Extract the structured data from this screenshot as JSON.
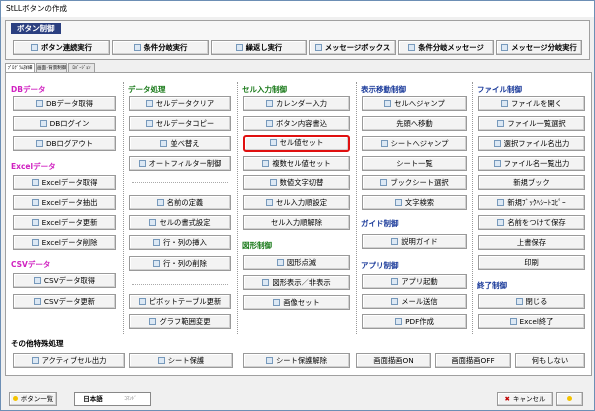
{
  "window": {
    "title": "StLLボタンの作成"
  },
  "top": {
    "title": "ボタン制御",
    "buttons": [
      "ボタン連続実行",
      "条件分岐実行",
      "繰返し実行",
      "メッセージボックス",
      "条件分岐メッセージ",
      "メッセージ分岐実行"
    ]
  },
  "tabs": [
    "ﾌﾟﾛｸﾞﾗﾑ詳細",
    "画面･背景制御",
    "ﾛﾊﾞｰｼﾞｮﾝ"
  ],
  "sections": {
    "db": {
      "title": "DBデータ",
      "buttons": [
        "DBデータ取得",
        "DBログイン",
        "DBログアウト"
      ]
    },
    "excel": {
      "title": "Excelデータ",
      "buttons": [
        "Excelデータ取得",
        "Excelデータ抽出",
        "Excelデータ更新",
        "Excelデータ削除"
      ]
    },
    "csv": {
      "title": "CSVデータ",
      "buttons": [
        "CSVデータ取得",
        "CSVデータ更新"
      ]
    },
    "data": {
      "title": "データ処理",
      "buttons": [
        "セルデータクリア",
        "セルデータコピー",
        "並べ替え",
        "オートフィルター制御",
        "名前の定義",
        "セルの書式設定",
        "行・列の挿入",
        "行・列の削除",
        "ピボットテーブル更新",
        "グラフ範囲変更"
      ]
    },
    "cell": {
      "title": "セル入力制御",
      "buttons": [
        "カレンダー入力",
        "ボタン内容書込",
        "セル値セット",
        "複数セル値セット",
        "数値文字切替",
        "セル入力順設定",
        "セル入力順解除"
      ]
    },
    "shape": {
      "title": "図形制御",
      "buttons": [
        "図形点滅",
        "図形表示／非表示",
        "画像セット"
      ]
    },
    "move": {
      "title": "表示移動制御",
      "buttons": [
        "セルへジャンプ",
        "先頭へ移動",
        "シートへジャンプ",
        "シート一覧",
        "ブックシート選択",
        "文字検索"
      ]
    },
    "guide": {
      "title": "ガイド制御",
      "buttons": [
        "説明ガイド"
      ]
    },
    "app": {
      "title": "アプリ制御",
      "buttons": [
        "アプリ起動",
        "メール送信",
        "PDF作成"
      ]
    },
    "file": {
      "title": "ファイル制御",
      "buttons": [
        "ファイルを開く",
        "ファイル一覧選択",
        "選択ファイル名出力",
        "ファイル名一覧出力",
        "新規ブック",
        "新規ﾌﾞｯｸﾍｼｰﾄｺﾋﾟｰ",
        "名前をつけて保存",
        "上書保存",
        "印刷"
      ]
    },
    "end": {
      "title": "終了制御",
      "buttons": [
        "閉じる",
        "Excel終了"
      ]
    },
    "other": {
      "title": "その他特殊処理",
      "buttons": [
        "アクティブセル出力",
        "シート保護",
        "シート保護解除",
        "画面描画ON",
        "画面描画OFF",
        "何もしない"
      ]
    }
  },
  "bottom": {
    "list_button": "ボタン一覧",
    "lang_ja": "日本語",
    "lang_code": "ｺﾏﾝﾄﾞ",
    "cancel": "キャンセル",
    "help": ""
  },
  "colors": {
    "section_magenta": "#d020c0",
    "section_blue": "#1a3a9a",
    "selected_border": "#e01010",
    "top_title_bg": "#2b3f80"
  }
}
